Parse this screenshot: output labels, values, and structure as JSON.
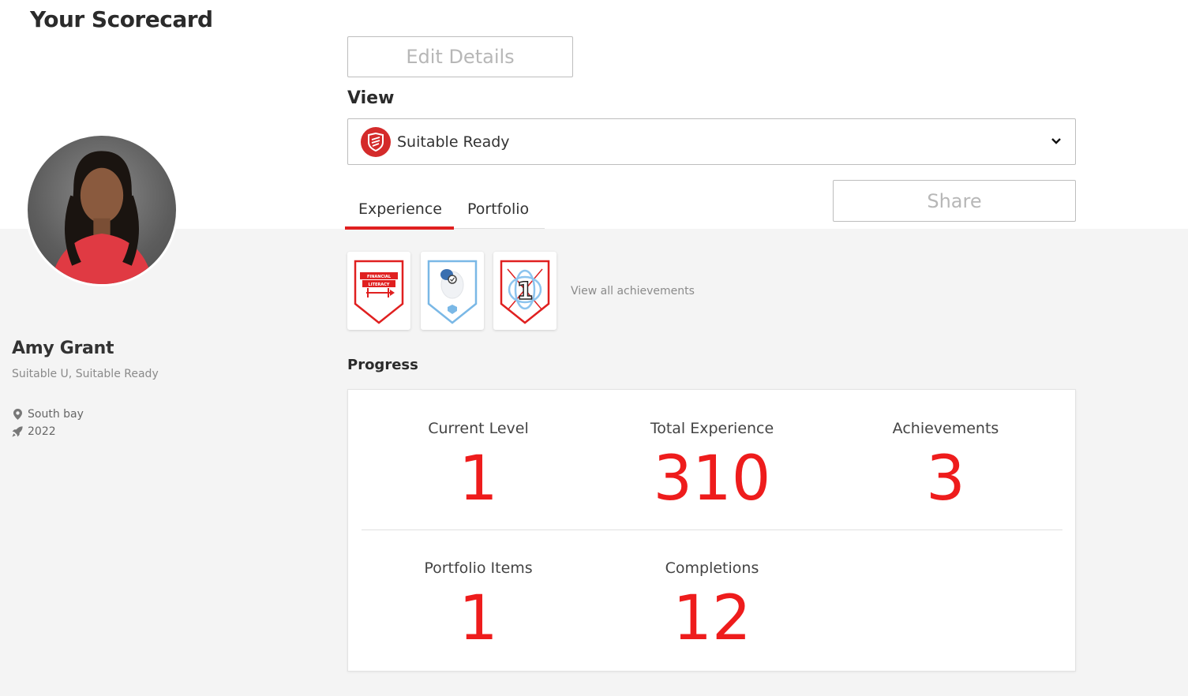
{
  "page": {
    "title": "Your Scorecard"
  },
  "profile": {
    "name": "Amy Grant",
    "subtitle": "Suitable U, Suitable Ready",
    "location": "South bay",
    "year": "2022"
  },
  "buttons": {
    "edit": "Edit Details",
    "share": "Share"
  },
  "view": {
    "label": "View",
    "selected": "Suitable Ready"
  },
  "tabs": [
    {
      "label": "Experience"
    },
    {
      "label": "Portfolio"
    }
  ],
  "achievements": {
    "view_all": "View all achievements",
    "badges": [
      {
        "icon": "financial-literacy-badge-icon",
        "text_line1": "FINANCIAL",
        "text_line2": "LITERACY"
      },
      {
        "icon": "brain-shield-badge-icon"
      },
      {
        "icon": "level-one-badge-icon",
        "text": "1"
      }
    ]
  },
  "progress": {
    "label": "Progress",
    "stats": [
      {
        "label": "Current Level",
        "value": "1"
      },
      {
        "label": "Total Experience",
        "value": "310"
      },
      {
        "label": "Achievements",
        "value": "3"
      },
      {
        "label": "Portfolio Items",
        "value": "1"
      },
      {
        "label": "Completions",
        "value": "12"
      }
    ]
  },
  "colors": {
    "accent": "#e02020",
    "stat_value": "#ee1c1c",
    "background_lower": "#f4f4f4"
  }
}
